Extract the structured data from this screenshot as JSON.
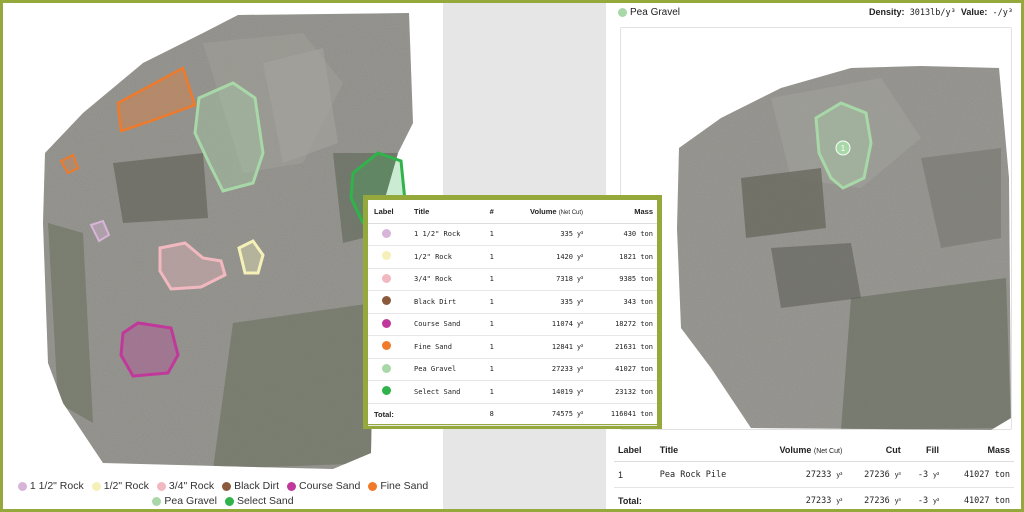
{
  "left_legend": [
    {
      "label": "1 1/2\" Rock",
      "color": "#d8b4d8"
    },
    {
      "label": "1/2\" Rock",
      "color": "#f4f0b8"
    },
    {
      "label": "3/4\" Rock",
      "color": "#f2b8c0"
    },
    {
      "label": "Black Dirt",
      "color": "#8b5a3c"
    },
    {
      "label": "Course Sand",
      "color": "#c0399a"
    },
    {
      "label": "Fine Sand",
      "color": "#f07a2a"
    },
    {
      "label": "Pea Gravel",
      "color": "#a8d8a8"
    },
    {
      "label": "Select Sand",
      "color": "#2fb34a"
    }
  ],
  "center_table": {
    "headers": {
      "label": "Label",
      "title": "Title",
      "count": "#",
      "volume": "Volume",
      "volume_sub": "(Net Cut)",
      "mass": "Mass"
    },
    "rows": [
      {
        "color": "#d8b4d8",
        "title": "1 1/2\" Rock",
        "count": "1",
        "volume": "335",
        "unit": "y³",
        "mass": "430 ton"
      },
      {
        "color": "#f4f0b8",
        "title": "1/2\" Rock",
        "count": "1",
        "volume": "1420",
        "unit": "y³",
        "mass": "1821 ton"
      },
      {
        "color": "#f2b8c0",
        "title": "3/4\" Rock",
        "count": "1",
        "volume": "7318",
        "unit": "y³",
        "mass": "9385 ton"
      },
      {
        "color": "#8b5a3c",
        "title": "Black Dirt",
        "count": "1",
        "volume": "335",
        "unit": "y³",
        "mass": "343 ton"
      },
      {
        "color": "#c0399a",
        "title": "Course Sand",
        "count": "1",
        "volume": "11074",
        "unit": "y³",
        "mass": "18272 ton"
      },
      {
        "color": "#f07a2a",
        "title": "Fine Sand",
        "count": "1",
        "volume": "12841",
        "unit": "y³",
        "mass": "21631 ton"
      },
      {
        "color": "#a8d8a8",
        "title": "Pea Gravel",
        "count": "1",
        "volume": "27233",
        "unit": "y³",
        "mass": "41027 ton"
      },
      {
        "color": "#2fb34a",
        "title": "Select Sand",
        "count": "1",
        "volume": "14019",
        "unit": "y³",
        "mass": "23132 ton"
      }
    ],
    "total": {
      "label": "Total:",
      "count": "8",
      "volume": "74575",
      "unit": "y³",
      "mass": "116041 ton"
    }
  },
  "right_header": {
    "title": "Pea Gravel",
    "color": "#a8d8a8",
    "density_label": "Density:",
    "density_value": "3013lb/y³",
    "value_label": "Value:",
    "value_value": "-/y³"
  },
  "right_map": {
    "marker_label": "1"
  },
  "right_table": {
    "headers": {
      "label": "Label",
      "title": "Title",
      "volume": "Volume",
      "volume_sub": "(Net Cut)",
      "cut": "Cut",
      "fill": "Fill",
      "mass": "Mass"
    },
    "rows": [
      {
        "label": "1",
        "title": "Pea Rock Pile",
        "volume": "27233",
        "cut": "27236",
        "fill": "-3",
        "unit": "y³",
        "mass": "41027 ton"
      }
    ],
    "total": {
      "label": "Total:",
      "volume": "27233",
      "cut": "27236",
      "fill": "-3",
      "unit": "y³",
      "mass": "41027 ton"
    }
  }
}
